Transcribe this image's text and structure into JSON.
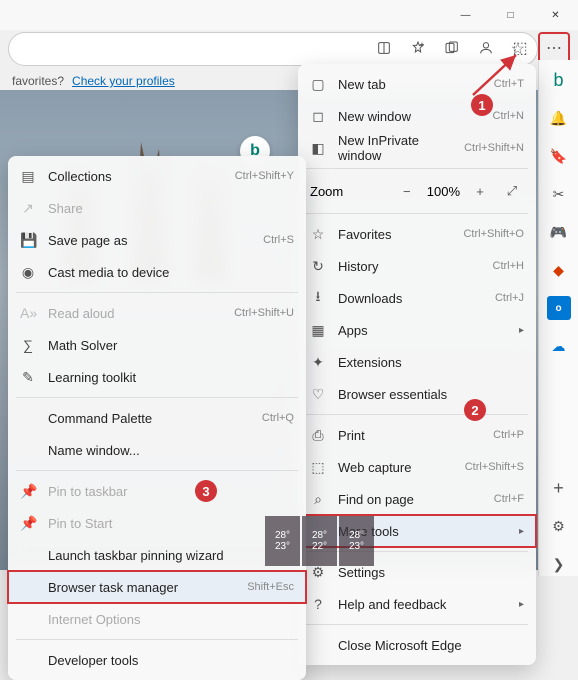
{
  "window_controls": {
    "minimize": "—",
    "maximize": "□",
    "close": "✕"
  },
  "favorites_bar": {
    "prefix": "favorites?",
    "link": "Check your profiles"
  },
  "main_menu": {
    "new_tab": {
      "label": "New tab",
      "shortcut": "Ctrl+T"
    },
    "new_window": {
      "label": "New window",
      "shortcut": "Ctrl+N"
    },
    "new_inprivate": {
      "label": "New InPrivate window",
      "shortcut": "Ctrl+Shift+N"
    },
    "zoom": {
      "label": "Zoom",
      "value": "100%"
    },
    "favorites": {
      "label": "Favorites",
      "shortcut": "Ctrl+Shift+O"
    },
    "history": {
      "label": "History",
      "shortcut": "Ctrl+H"
    },
    "downloads": {
      "label": "Downloads",
      "shortcut": "Ctrl+J"
    },
    "apps": {
      "label": "Apps"
    },
    "extensions": {
      "label": "Extensions"
    },
    "browser_essentials": {
      "label": "Browser essentials"
    },
    "print": {
      "label": "Print",
      "shortcut": "Ctrl+P"
    },
    "web_capture": {
      "label": "Web capture",
      "shortcut": "Ctrl+Shift+S"
    },
    "find": {
      "label": "Find on page",
      "shortcut": "Ctrl+F"
    },
    "more_tools": {
      "label": "More tools"
    },
    "settings": {
      "label": "Settings"
    },
    "help": {
      "label": "Help and feedback"
    },
    "close_edge": {
      "label": "Close Microsoft Edge"
    }
  },
  "sub_menu": {
    "collections": {
      "label": "Collections",
      "shortcut": "Ctrl+Shift+Y"
    },
    "share": {
      "label": "Share"
    },
    "save_page": {
      "label": "Save page as",
      "shortcut": "Ctrl+S"
    },
    "cast": {
      "label": "Cast media to device"
    },
    "read_aloud": {
      "label": "Read aloud",
      "shortcut": "Ctrl+Shift+U"
    },
    "math_solver": {
      "label": "Math Solver"
    },
    "learning": {
      "label": "Learning toolkit"
    },
    "command_palette": {
      "label": "Command Palette",
      "shortcut": "Ctrl+Q"
    },
    "name_window": {
      "label": "Name window..."
    },
    "pin_taskbar": {
      "label": "Pin to taskbar"
    },
    "pin_start": {
      "label": "Pin to Start"
    },
    "pinning_wizard": {
      "label": "Launch taskbar pinning wizard"
    },
    "task_manager": {
      "label": "Browser task manager",
      "shortcut": "Shift+Esc"
    },
    "internet_options": {
      "label": "Internet Options"
    },
    "developer_tools": {
      "label": "Developer tools"
    }
  },
  "callouts": {
    "one": "1",
    "two": "2",
    "three": "3"
  },
  "weather": [
    {
      "hi": "28°",
      "lo": "23°"
    },
    {
      "hi": "28°",
      "lo": "22°"
    },
    {
      "hi": "28°",
      "lo": "23°"
    }
  ]
}
